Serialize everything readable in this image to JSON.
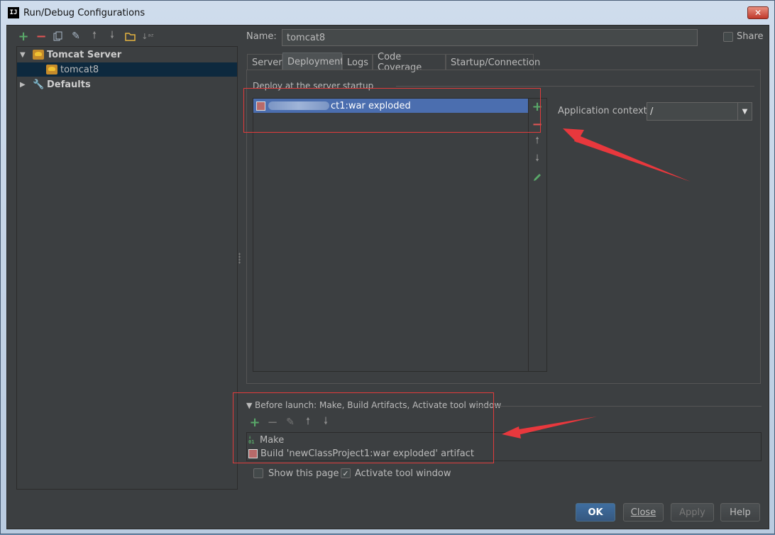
{
  "window": {
    "title": "Run/Debug Configurations",
    "app_icon_text": "IJ"
  },
  "left_toolbar": {
    "icons": [
      "add-icon",
      "remove-icon",
      "copy-icon",
      "wrench-icon",
      "move-up-icon",
      "move-down-icon",
      "folder-icon",
      "sort-icon"
    ]
  },
  "tree": {
    "items": [
      {
        "label": "Tomcat Server",
        "expanded": true
      },
      {
        "label": "tomcat8",
        "selected": true
      },
      {
        "label": "Defaults",
        "expanded": false
      }
    ]
  },
  "config": {
    "name_label": "Name:",
    "name_value": "tomcat8",
    "share_label": "Share"
  },
  "tabs": [
    "Server",
    "Deployment",
    "Logs",
    "Code Coverage",
    "Startup/Connection"
  ],
  "active_tab": "Deployment",
  "deployment": {
    "section_title": "Deploy at the server startup",
    "artifact_suffix": "ct1:war exploded",
    "context_label": "Application context:",
    "context_value": "/"
  },
  "before_launch": {
    "title": "Before launch: Make, Build Artifacts, Activate tool window",
    "items": [
      {
        "label": "Make"
      },
      {
        "label": "Build 'newClassProject1:war exploded' artifact"
      }
    ],
    "show_page_label": "Show this page",
    "activate_label": "Activate tool window",
    "activate_checked": true
  },
  "buttons": {
    "ok": "OK",
    "close": "Close",
    "apply": "Apply",
    "help": "Help"
  },
  "colors": {
    "accent_red": "#e8383d",
    "selection": "#4b6eaf",
    "plus_green": "#59a869"
  }
}
